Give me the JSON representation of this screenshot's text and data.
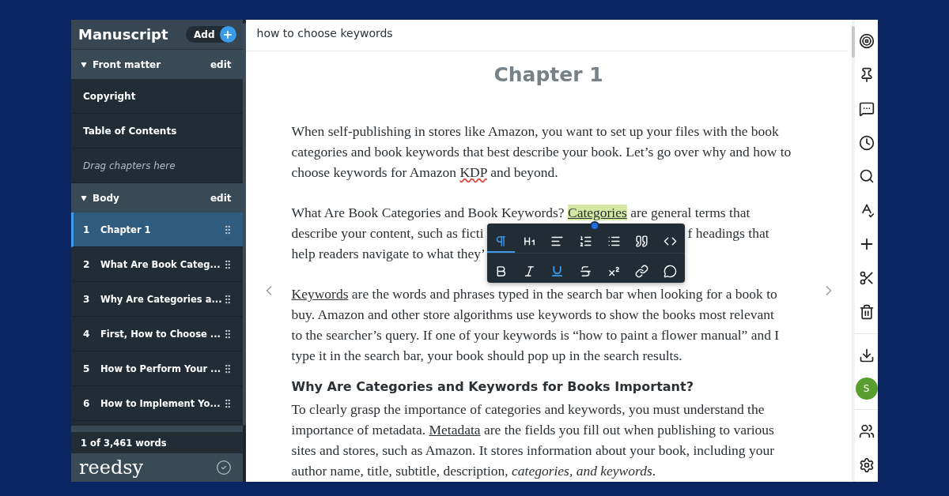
{
  "sidebar": {
    "title": "Manuscript",
    "add_label": "Add",
    "sections": [
      {
        "title": "Front matter",
        "edit": "edit",
        "expanded": true,
        "items": [
          {
            "kind": "page",
            "label": "Copyright"
          },
          {
            "kind": "page",
            "label": "Table of Contents"
          },
          {
            "kind": "hint",
            "label": "Drag chapters here"
          }
        ]
      },
      {
        "title": "Body",
        "edit": "edit",
        "expanded": true,
        "items": [
          {
            "kind": "chapter",
            "number": "1",
            "label": "Chapter 1",
            "selected": true
          },
          {
            "kind": "chapter",
            "number": "2",
            "label": "What Are Book Categ...",
            "selected": false
          },
          {
            "kind": "chapter",
            "number": "3",
            "label": "Why Are Categories a...",
            "selected": false
          },
          {
            "kind": "chapter",
            "number": "4",
            "label": "First, How to Choose ...",
            "selected": false
          },
          {
            "kind": "chapter",
            "number": "5",
            "label": "How to Perform Your ...",
            "selected": false
          },
          {
            "kind": "chapter",
            "number": "6",
            "label": "How to Implement Yo...",
            "selected": false
          }
        ]
      }
    ],
    "word_count": "1 of 3,461 words",
    "logo": "reedsy"
  },
  "editor": {
    "subtitle": "how to choose keywords",
    "chapter_title": "Chapter 1",
    "blocks": [
      {
        "kind": "paragraph",
        "lines": [
          [
            {
              "kind": "text",
              "text": "When self-publishing in stores like Amazon, you want to set up your files with the book"
            }
          ],
          [
            {
              "kind": "text",
              "text": "categories and book keywords that best describe your book. Let’s go over why and how to"
            }
          ],
          [
            {
              "kind": "text",
              "text": "choose keywords for Amazon "
            },
            {
              "kind": "misspelled",
              "text": "KDP"
            },
            {
              "kind": "text",
              "text": " and beyond."
            }
          ]
        ]
      },
      {
        "kind": "paragraph",
        "toolbar": true,
        "lines": [
          [
            {
              "kind": "text",
              "text": "What Are Book Categories and Book Keywords? "
            },
            {
              "kind": "highlight-link",
              "text": "Categories"
            },
            {
              "kind": "text",
              "text": " are general terms that"
            }
          ],
          [
            {
              "kind": "text",
              "text": "describe your content, such as ficti"
            },
            {
              "kind": "gap"
            },
            {
              "kind": "text",
              "text": "f headings that"
            }
          ],
          [
            {
              "kind": "text",
              "text": "help readers navigate to what they’"
            }
          ]
        ]
      },
      {
        "kind": "paragraph",
        "lines": [
          [
            {
              "kind": "link",
              "text": "Keywords"
            },
            {
              "kind": "text",
              "text": " are the words and phrases typed in the search bar when looking for a book to"
            }
          ],
          [
            {
              "kind": "text",
              "text": "buy. Amazon and other store algorithms use keywords to show the books most relevant"
            }
          ],
          [
            {
              "kind": "text",
              "text": "to the searcher’s query. If one of your keywords is “how to paint a flower manual” and I"
            }
          ],
          [
            {
              "kind": "text",
              "text": "type it in the search bar, your book should pop up in the search results."
            }
          ]
        ]
      },
      {
        "kind": "heading",
        "text": "Why Are Categories and Keywords for Books Important?"
      },
      {
        "kind": "paragraph",
        "tight": true,
        "lines": [
          [
            {
              "kind": "text",
              "text": "To clearly grasp the importance of categories and keywords, you must understand the"
            }
          ],
          [
            {
              "kind": "text",
              "text": "importance of metadata. "
            },
            {
              "kind": "link",
              "text": "Metadata"
            },
            {
              "kind": "text",
              "text": " are the fields you fill out when publishing to various"
            }
          ],
          [
            {
              "kind": "text",
              "text": "sites and stores, such as Amazon. It stores information about your book, including your"
            }
          ],
          [
            {
              "kind": "text",
              "text": "author name, title, subtitle, description, "
            },
            {
              "kind": "italic",
              "text": "categories, and keywords"
            },
            {
              "kind": "text",
              "text": "."
            }
          ]
        ]
      }
    ],
    "toolbar": [
      [
        {
          "kind": "paragraph",
          "selected": true,
          "active": false
        },
        {
          "kind": "heading",
          "selected": false,
          "active": false
        },
        {
          "kind": "align",
          "selected": false,
          "active": false
        },
        {
          "kind": "ordered-list",
          "selected": false,
          "active": false
        },
        {
          "kind": "bullet-list",
          "selected": false,
          "active": false
        },
        {
          "kind": "quote",
          "selected": false,
          "active": false
        },
        {
          "kind": "code",
          "selected": false,
          "active": false
        }
      ],
      [
        {
          "kind": "bold",
          "selected": false,
          "active": false
        },
        {
          "kind": "italic",
          "selected": false,
          "active": false
        },
        {
          "kind": "underline",
          "selected": false,
          "active": true
        },
        {
          "kind": "strike",
          "selected": false,
          "active": false
        },
        {
          "kind": "superscript",
          "selected": false,
          "active": false
        },
        {
          "kind": "link",
          "selected": false,
          "active": false
        },
        {
          "kind": "comment",
          "selected": false,
          "active": false
        }
      ]
    ]
  },
  "rail": {
    "avatar": {
      "initial": "S",
      "color": "#5a9e2f"
    }
  }
}
